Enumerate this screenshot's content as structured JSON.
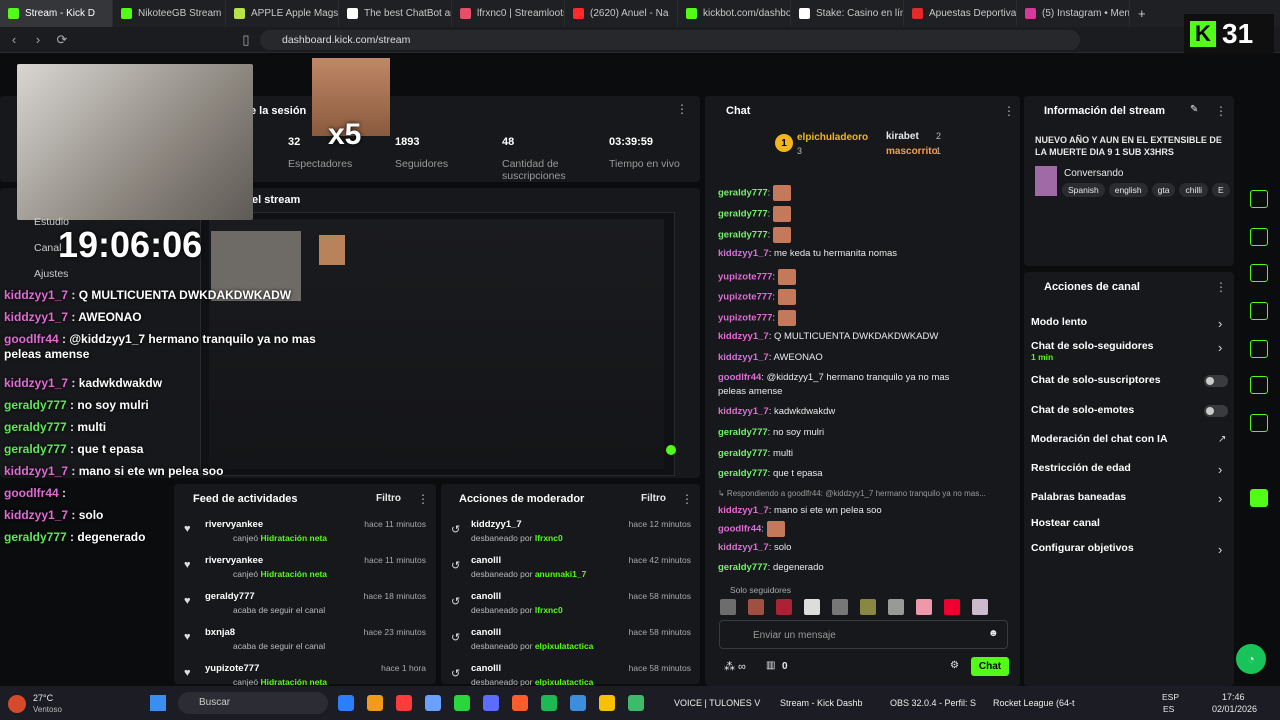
{
  "browser": {
    "tabs": [
      {
        "title": "Stream - Kick D",
        "color": "#53fc18",
        "active": true
      },
      {
        "title": "NikoteeGB Stream",
        "color": "#53fc18"
      },
      {
        "title": "APPLE Apple Magsafe",
        "color": "#b6e34a"
      },
      {
        "title": "The best ChatBot and",
        "color": "#ffffff"
      },
      {
        "title": "lfrxnc0 | Streamloots |",
        "color": "#e84d6a"
      },
      {
        "title": "(2620) Anuel - Na",
        "color": "#ff2b2b"
      },
      {
        "title": "kickbot.com/dashboa",
        "color": "#53fc18"
      },
      {
        "title": "Stake: Casino en línea",
        "color": "#ffffff"
      },
      {
        "title": "Apuestas Deportivas",
        "color": "#e22a2a"
      },
      {
        "title": "(5) Instagram • Mensa",
        "color": "#d6399b"
      }
    ],
    "new_tab": "+",
    "url": "dashboard.kick.com/stream",
    "kick_badge": "31"
  },
  "session": {
    "title_partial": "e la sesión",
    "emote_caption": "x5",
    "stats": [
      {
        "value": "32",
        "label": "Espectadores"
      },
      {
        "value": "1893",
        "label": "Seguidores"
      },
      {
        "value": "48",
        "label": "Cantidad de suscripciones"
      },
      {
        "value": "03:39:59",
        "label": "Tiempo en vivo"
      }
    ],
    "preview_title_partial": "el stream"
  },
  "overlay": {
    "clock": "19:06:06",
    "menu": [
      "Estudio",
      "Canal",
      "Ajustes"
    ],
    "lines": [
      {
        "user": "kiddzyy1_7",
        "text": "Q MULTICUENTA DWKDAKDWKADW",
        "cls": "u-p"
      },
      {
        "user": "kiddzyy1_7",
        "text": "AWEONAO",
        "cls": "u-p"
      },
      {
        "user": "goodlfr44",
        "text": "@kiddzyy1_7 hermano tranquilo ya no mas peleas amense",
        "cls": "u-p"
      },
      {
        "user": "kiddzyy1_7",
        "text": "kadwkdwakdw",
        "cls": "u-p"
      },
      {
        "user": "geraldy777",
        "text": "no soy mulri",
        "cls": "u-g"
      },
      {
        "user": "geraldy777",
        "text": "multi",
        "cls": "u-g"
      },
      {
        "user": "geraldy777",
        "text": "que t epasa",
        "cls": "u-g"
      },
      {
        "user": "kiddzyy1_7",
        "text": "mano si ete wn pelea soo",
        "cls": "u-p"
      },
      {
        "user": "goodlfr44",
        "text": "",
        "cls": "u-p"
      },
      {
        "user": "kiddzyy1_7",
        "text": "solo",
        "cls": "u-p"
      },
      {
        "user": "geraldy777",
        "text": "degenerado",
        "cls": "u-g"
      }
    ]
  },
  "chat": {
    "title": "Chat",
    "leaders": [
      {
        "name": "elpichuladeoro",
        "count": "3",
        "rank": "1"
      },
      {
        "name": "kirabet",
        "count": "2"
      },
      {
        "name": "mascorrito",
        "count": "1"
      }
    ],
    "lines": [
      {
        "user": "geraldy777",
        "text": "",
        "emote": true,
        "cls": "u-o"
      },
      {
        "user": "geraldy777",
        "text": "",
        "emote": true,
        "cls": "u-o"
      },
      {
        "user": "geraldy777",
        "text": "",
        "emote": true,
        "cls": "u-o"
      },
      {
        "user": "kiddzyy1_7",
        "text": "me keda tu hermanita nomas",
        "cls": "u-p"
      },
      {
        "user": "yupizote777",
        "text": "",
        "emote": true,
        "cls": "u-p"
      },
      {
        "user": "yupizote777",
        "text": "",
        "emote": true,
        "cls": "u-p"
      },
      {
        "user": "yupizote777",
        "text": "",
        "emote": true,
        "cls": "u-p"
      },
      {
        "user": "kiddzyy1_7",
        "text": "Q MULTICUENTA DWKDAKDWKADW",
        "cls": "u-p"
      },
      {
        "user": "kiddzyy1_7",
        "text": "AWEONAO",
        "cls": "u-p"
      },
      {
        "user": "goodlfr44",
        "text": "@kiddzyy1_7 hermano tranquilo ya no mas",
        "cls": "u-p"
      },
      {
        "user": "",
        "text": "peleas amense",
        "cls": "u-p"
      },
      {
        "user": "kiddzyy1_7",
        "text": "kadwkdwakdw",
        "cls": "u-p"
      },
      {
        "user": "geraldy777",
        "text": "no soy mulri",
        "cls": "u-o"
      },
      {
        "user": "geraldy777",
        "text": "multi",
        "cls": "u-o"
      },
      {
        "user": "geraldy777",
        "text": "que t epasa",
        "cls": "u-o"
      },
      {
        "user": "",
        "text": "↳ Respondiendo a goodlfr44: @kiddzyy1_7 hermano tranquilo ya no mas...",
        "cls": "u-p"
      },
      {
        "user": "kiddzyy1_7",
        "text": "mano si ete wn pelea soo",
        "cls": "u-p"
      },
      {
        "user": "goodlfr44",
        "text": "",
        "emote": true,
        "cls": "u-p"
      },
      {
        "user": "kiddzyy1_7",
        "text": "solo",
        "cls": "u-p"
      },
      {
        "user": "geraldy777",
        "text": "degenerado",
        "cls": "u-o"
      }
    ],
    "followers_only": "Solo seguidores",
    "placeholder": "Enviar un mensaje",
    "points": "0",
    "send": "Chat"
  },
  "stream_info": {
    "title": "Información del stream",
    "stream_title": "NUEVO AÑO Y AUN EN EL EXTENSIBLE DE LA MUERTE DIA 9 1 SUB X3HRS",
    "category": "Conversando",
    "tags": [
      "Spanish",
      "english",
      "gta",
      "chilli",
      "E"
    ]
  },
  "channel_actions": {
    "title": "Acciones de canal",
    "items": [
      {
        "label": "Modo lento",
        "kind": "chev"
      },
      {
        "label": "Chat de solo-seguidores",
        "sub": "1 min",
        "kind": "chev"
      },
      {
        "label": "Chat de solo-suscriptores",
        "kind": "toggle"
      },
      {
        "label": "Chat de solo-emotes",
        "kind": "toggle"
      },
      {
        "label": "Moderación del chat con IA",
        "kind": "ext"
      },
      {
        "label": "Restricción de edad",
        "kind": "chev"
      },
      {
        "label": "Palabras baneadas",
        "kind": "chev"
      },
      {
        "label": "Hostear canal",
        "kind": "none"
      },
      {
        "label": "Configurar objetivos",
        "kind": "chev"
      }
    ]
  },
  "activity": {
    "title": "Feed de actividades",
    "filter": "Filtro",
    "items": [
      {
        "user": "rivervyankee",
        "action": "canjeó",
        "reward": "Hidratación neta",
        "time": "hace 11 minutos"
      },
      {
        "user": "rivervyankee",
        "action": "canjeó",
        "reward": "Hidratación neta",
        "time": "hace 11 minutos"
      },
      {
        "user": "geraldy777",
        "action": "acaba de seguir el canal",
        "reward": "",
        "time": "hace 18 minutos"
      },
      {
        "user": "bxnja8",
        "action": "acaba de seguir el canal",
        "reward": "",
        "time": "hace 23 minutos"
      },
      {
        "user": "yupizote777",
        "action": "canjeó",
        "reward": "Hidratación neta",
        "time": "hace 1 hora"
      }
    ]
  },
  "moderator": {
    "title": "Acciones de moderador",
    "filter": "Filtro",
    "items": [
      {
        "user": "kiddzyy1_7",
        "action": "desbaneado por",
        "by": "lfrxnc0",
        "time": "hace 12 minutos"
      },
      {
        "user": "canolll",
        "action": "desbaneado por",
        "by": "anunnaki1_7",
        "time": "hace 42 minutos"
      },
      {
        "user": "canolll",
        "action": "desbaneado por",
        "by": "lfrxnc0",
        "time": "hace 58 minutos"
      },
      {
        "user": "canolll",
        "action": "desbaneado por",
        "by": "elpixulatactica",
        "time": "hace 58 minutos"
      },
      {
        "user": "canolll",
        "action": "desbaneado por",
        "by": "elpixulatactica",
        "time": "hace 58 minutos"
      }
    ]
  },
  "taskbar": {
    "weather_temp": "27°C",
    "weather_desc": "Ventoso",
    "search": "Buscar",
    "apps": [
      "VOICE | TULONES V",
      "Stream - Kick Dashb",
      "OBS 32.0.4 - Perfil: S",
      "Rocket League (64-t"
    ],
    "lang": "ESP",
    "lang2": "ES",
    "time": "17:46",
    "date": "02/01/2026"
  },
  "colors": {
    "accent": "#53fc18",
    "panel": "#17181b"
  }
}
